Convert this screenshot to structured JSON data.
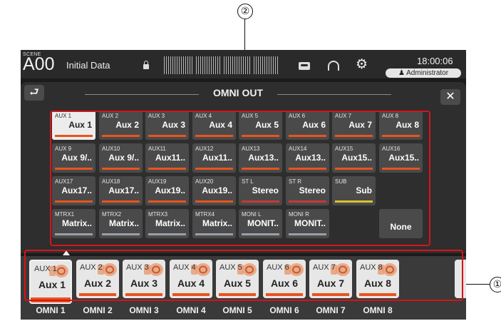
{
  "callouts": {
    "grid": "②",
    "strip": "①"
  },
  "status_bar": {
    "scene_caption": "SCENE",
    "scene_number": "A00",
    "scene_title": "Initial Data",
    "time": "18:00:06",
    "user": "Administrator",
    "icons": [
      "lock-icon",
      "level-meter",
      "recorder-icon",
      "headphones-icon",
      "gear-icon",
      "user-icon"
    ]
  },
  "panel": {
    "title": "OMNI OUT",
    "back_icon": "back-arrow-icon",
    "close_icon": "close-icon"
  },
  "colors": {
    "accent_orange": "#e8541d",
    "stereo_red": "#c63a36",
    "sub_yellow": "#d8c22e",
    "highlight_red": "#d8131a",
    "matrix_gray": "#9aa0aa"
  },
  "source_grid": [
    [
      {
        "top": "AUX 1",
        "name": "Aux 1",
        "bar": "#e8541d",
        "active": true
      },
      {
        "top": "AUX 2",
        "name": "Aux 2",
        "bar": "#e8541d"
      },
      {
        "top": "AUX 3",
        "name": "Aux 3",
        "bar": "#e8541d"
      },
      {
        "top": "AUX 4",
        "name": "Aux 4",
        "bar": "#e8541d"
      },
      {
        "top": "AUX 5",
        "name": "Aux 5",
        "bar": "#e8541d"
      },
      {
        "top": "AUX 6",
        "name": "Aux 6",
        "bar": "#e8541d"
      },
      {
        "top": "AUX 7",
        "name": "Aux 7",
        "bar": "#e8541d"
      },
      {
        "top": "AUX 8",
        "name": "Aux 8",
        "bar": "#e8541d"
      }
    ],
    [
      {
        "top": "AUX 9",
        "name": "Aux 9/..",
        "bar": "#e8541d"
      },
      {
        "top": "AUX10",
        "name": "Aux 9/..",
        "bar": "#e8541d"
      },
      {
        "top": "AUX11",
        "name": "Aux11..",
        "bar": "#e8541d"
      },
      {
        "top": "AUX12",
        "name": "Aux11..",
        "bar": "#e8541d"
      },
      {
        "top": "AUX13",
        "name": "Aux13..",
        "bar": "#e8541d"
      },
      {
        "top": "AUX14",
        "name": "Aux13..",
        "bar": "#e8541d"
      },
      {
        "top": "AUX15",
        "name": "Aux15..",
        "bar": "#e8541d"
      },
      {
        "top": "AUX16",
        "name": "Aux15..",
        "bar": "#e8541d"
      }
    ],
    [
      {
        "top": "AUX17",
        "name": "Aux17..",
        "bar": "#e8541d"
      },
      {
        "top": "AUX18",
        "name": "Aux17..",
        "bar": "#e8541d"
      },
      {
        "top": "AUX19",
        "name": "Aux19..",
        "bar": "#e8541d"
      },
      {
        "top": "AUX20",
        "name": "Aux19..",
        "bar": "#e8541d"
      },
      {
        "top": "ST L",
        "name": "Stereo",
        "bar": "#c63a36"
      },
      {
        "top": "ST R",
        "name": "Stereo",
        "bar": "#c63a36"
      },
      {
        "top": "SUB",
        "name": "Sub",
        "bar": "#d8c22e"
      }
    ],
    [
      {
        "top": "MTRX1",
        "name": "Matrix..",
        "bar": "#9aa0aa"
      },
      {
        "top": "MTRX2",
        "name": "Matrix..",
        "bar": "#9aa0aa"
      },
      {
        "top": "MTRX3",
        "name": "Matrix..",
        "bar": "#9aa0aa"
      },
      {
        "top": "MTRX4",
        "name": "Matrix..",
        "bar": "#9aa0aa"
      },
      {
        "top": "MONI L",
        "name": "MONIT..",
        "bar": "#9aa0aa"
      },
      {
        "top": "MONI R",
        "name": "MONIT..",
        "bar": "#9aa0aa"
      },
      {
        "top": "",
        "name": "None",
        "none": true
      }
    ]
  ],
  "omni_outputs": [
    {
      "top": "AUX 1",
      "name": "Aux 1",
      "label": "OMNI 1",
      "active": true
    },
    {
      "top": "AUX 2",
      "name": "Aux 2",
      "label": "OMNI 2"
    },
    {
      "top": "AUX 3",
      "name": "Aux 3",
      "label": "OMNI 3"
    },
    {
      "top": "AUX 4",
      "name": "Aux 4",
      "label": "OMNI 4"
    },
    {
      "top": "AUX 5",
      "name": "Aux 5",
      "label": "OMNI 5"
    },
    {
      "top": "AUX 6",
      "name": "Aux 6",
      "label": "OMNI 6"
    },
    {
      "top": "AUX 7",
      "name": "Aux 7",
      "label": "OMNI 7"
    },
    {
      "top": "AUX 8",
      "name": "Aux 8",
      "label": "OMNI 8"
    }
  ]
}
